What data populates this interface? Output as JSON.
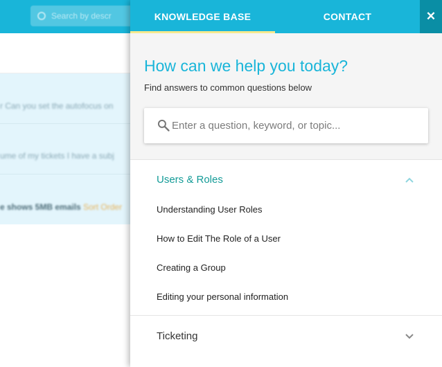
{
  "background": {
    "search_placeholder": "Search by descr",
    "rows": [
      {
        "text": "r Can you set the autofocus on"
      },
      {
        "text": "ume of my tickets I have a subj"
      },
      {
        "bold": "e shows 5MB emails",
        "amber": "Sort Order"
      }
    ]
  },
  "panel": {
    "tabs": [
      {
        "label": "KNOWLEDGE BASE",
        "active": true
      },
      {
        "label": "CONTACT",
        "active": false
      }
    ],
    "close_label": "✕",
    "heading": "How can we help you today?",
    "subheading": "Find answers to common questions below",
    "search": {
      "value": "",
      "placeholder": "Enter a question, keyword, or topic..."
    },
    "sections": [
      {
        "title": "Users & Roles",
        "expanded": true,
        "icon": "chevron-up-icon",
        "articles": [
          "Understanding User Roles",
          "How to Edit The Role of a User",
          "Creating a Group",
          "Editing your personal information"
        ]
      },
      {
        "title": "Ticketing",
        "expanded": false,
        "icon": "chevron-down-icon"
      }
    ]
  },
  "colors": {
    "accent": "#19b5d9",
    "close_bg": "#0a8ea5",
    "tab_indicator": "#f7e98e",
    "section_active": "#139b97",
    "section_inactive": "#333333"
  }
}
